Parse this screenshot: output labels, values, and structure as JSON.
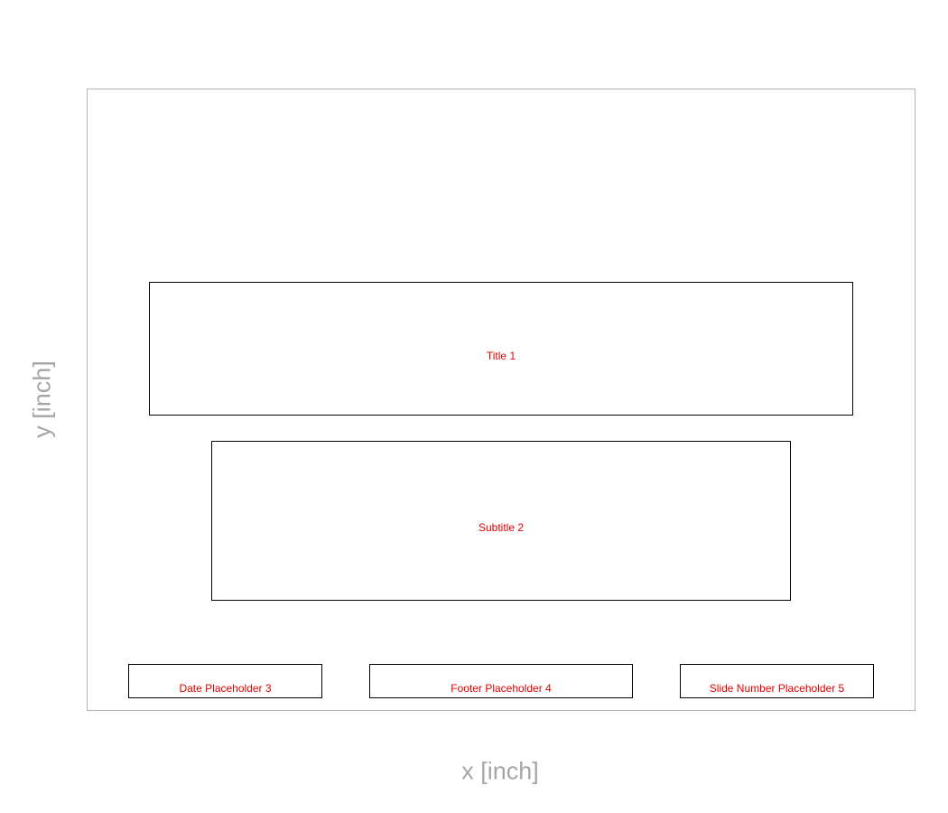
{
  "axes": {
    "x_label": "x [inch]",
    "y_label": "y [inch]"
  },
  "placeholders": {
    "title": "Title 1",
    "subtitle": "Subtitle 2",
    "date": "Date Placeholder 3",
    "footer": "Footer Placeholder 4",
    "slide_number": "Slide Number Placeholder 5"
  },
  "colors": {
    "axis_label": "#a6a6a6",
    "frame_border": "#b3b3b3",
    "placeholder_border": "#000000",
    "placeholder_label": "#e00000"
  }
}
